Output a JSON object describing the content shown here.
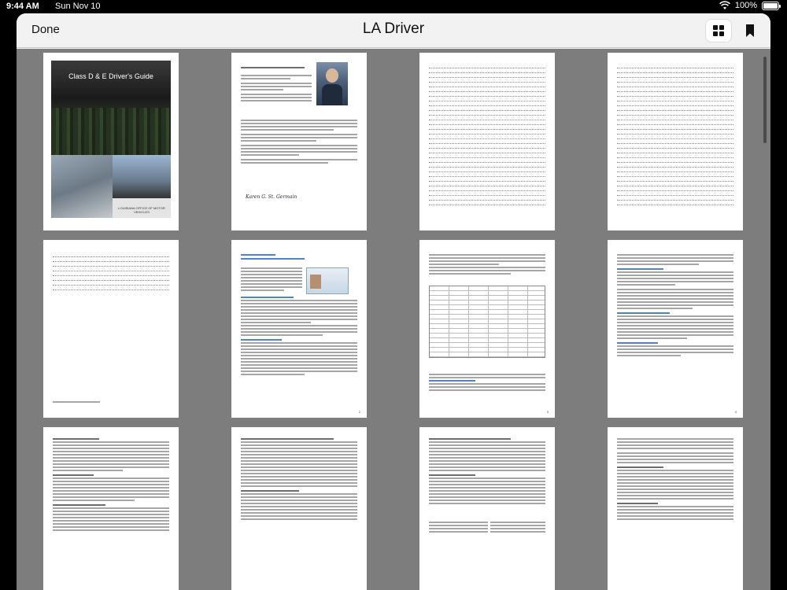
{
  "status_bar": {
    "time": "9:44 AM",
    "date": "Sun Nov 10",
    "battery": "100%"
  },
  "nav": {
    "done_label": "Done",
    "title": "LA Driver",
    "grid_icon": "grid-icon",
    "bookmark_icon": "bookmark-icon"
  },
  "pages": {
    "cover": {
      "title": "Class D & E Driver's Guide",
      "footer": "LOUISIANA OFFICE OF MOTOR VEHICLES"
    },
    "p2_heading": "Message from the Commissioner",
    "p2_signature": "Karen G. St. Germain",
    "p6_chapter": "CHAPTER 1",
    "p6_heading": "GETTING A DRIVER'S LICENSE",
    "p7_page_num": "3",
    "p6_page_num": "2",
    "p8_page_num": "4"
  },
  "colors": {
    "canvas": "#7d7d7d",
    "bar": "#f2f2f2",
    "link_blue": "#4a86c8"
  }
}
